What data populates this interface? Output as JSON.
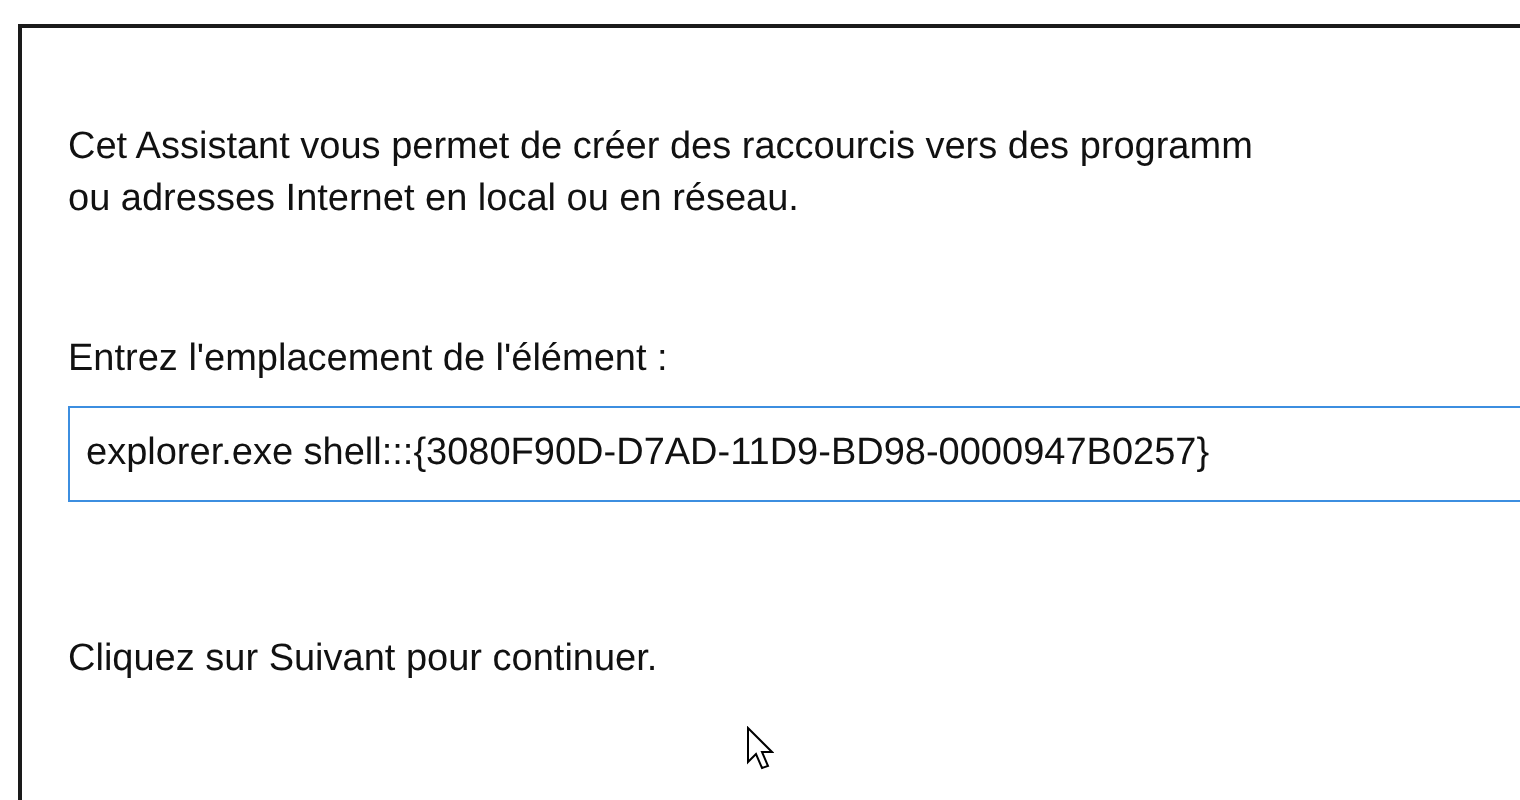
{
  "intro": {
    "lines": [
      "Cet Assistant vous permet de créer des raccourcis vers des programm",
      "ou adresses Internet en local ou en réseau."
    ]
  },
  "location": {
    "label": "Entrez l'emplacement de l'élément :",
    "value": "explorer.exe shell:::{3080F90D-D7AD-11D9-BD98-0000947B0257}"
  },
  "hint": "Cliquez sur Suivant pour continuer."
}
